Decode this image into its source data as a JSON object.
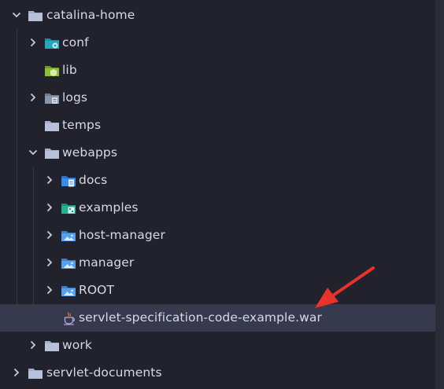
{
  "tree": {
    "selected_color": "#373a4c",
    "items": [
      {
        "label": "catalina-home",
        "chevron": "chevron-down",
        "icon": "folder-icon"
      },
      {
        "label": "conf",
        "chevron": "chevron-right",
        "icon": "folder-config-icon"
      },
      {
        "label": "lib",
        "chevron": "",
        "icon": "folder-lib-icon"
      },
      {
        "label": "logs",
        "chevron": "chevron-right",
        "icon": "folder-logs-icon"
      },
      {
        "label": "temps",
        "chevron": "",
        "icon": "folder-icon"
      },
      {
        "label": "webapps",
        "chevron": "chevron-down",
        "icon": "folder-icon"
      },
      {
        "label": "docs",
        "chevron": "chevron-right",
        "icon": "folder-docs-icon"
      },
      {
        "label": "examples",
        "chevron": "chevron-right",
        "icon": "folder-examples-icon"
      },
      {
        "label": "host-manager",
        "chevron": "chevron-right",
        "icon": "folder-images-icon"
      },
      {
        "label": "manager",
        "chevron": "chevron-right",
        "icon": "folder-images-icon"
      },
      {
        "label": "ROOT",
        "chevron": "chevron-right",
        "icon": "folder-images-icon"
      },
      {
        "label": "servlet-specification-code-example.war",
        "chevron": "",
        "icon": "java-archive-icon",
        "selected": true
      },
      {
        "label": "work",
        "chevron": "chevron-right",
        "icon": "folder-icon"
      },
      {
        "label": "servlet-documents",
        "chevron": "chevron-right",
        "icon": "folder-icon"
      }
    ]
  },
  "annotation": {
    "type": "arrow",
    "color": "#e8322b",
    "points_to": "servlet-specification-code-example.war"
  }
}
